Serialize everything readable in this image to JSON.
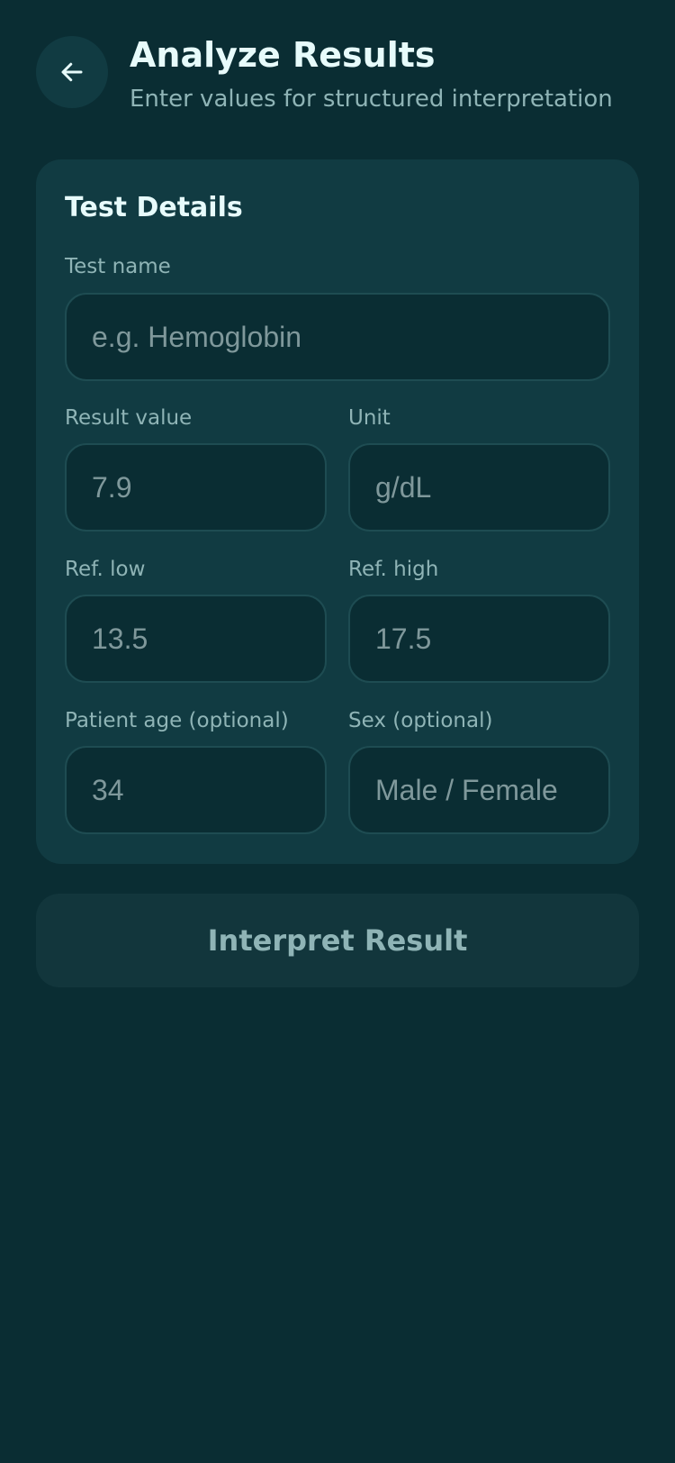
{
  "header": {
    "back_icon": "arrow-left-icon",
    "title": "Analyze Results",
    "subtitle": "Enter values for structured interpretation"
  },
  "card": {
    "title": "Test Details",
    "fields": {
      "test_name": {
        "label": "Test name",
        "placeholder": "e.g. Hemoglobin",
        "value": ""
      },
      "result_value": {
        "label": "Result value",
        "placeholder": "7.9",
        "value": ""
      },
      "unit": {
        "label": "Unit",
        "placeholder": "g/dL",
        "value": ""
      },
      "ref_low": {
        "label": "Ref. low",
        "placeholder": "13.5",
        "value": ""
      },
      "ref_high": {
        "label": "Ref. high",
        "placeholder": "17.5",
        "value": ""
      },
      "age": {
        "label": "Patient age (optional)",
        "placeholder": "34",
        "value": ""
      },
      "sex": {
        "label": "Sex (optional)",
        "placeholder": "Male / Female",
        "value": ""
      }
    }
  },
  "action": {
    "label": "Interpret Result"
  },
  "colors": {
    "background": "#0a2d33",
    "card": "#113b42",
    "input": "#0a2d33",
    "title_text": "#e7fbfb",
    "muted_text": "#8fb4b6",
    "placeholder_text": "#7f989b",
    "button": "#12363c"
  }
}
